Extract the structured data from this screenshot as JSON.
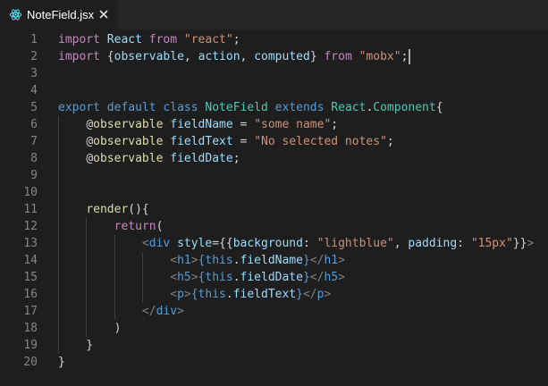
{
  "tab": {
    "title": "NoteField.jsx",
    "icon": "react-icon",
    "close_icon": "close-icon"
  },
  "colors": {
    "background": "#1e1e1e",
    "keyword": "#569cd6",
    "import_keyword": "#c586c0",
    "string": "#ce9178",
    "class_name": "#4ec9b0",
    "identifier": "#9cdcfe",
    "function": "#dcdcaa",
    "line_number": "#858585"
  },
  "lines": [
    {
      "n": "1",
      "tokens": [
        [
          "imp",
          "import"
        ],
        [
          "txt",
          " "
        ],
        [
          "ident",
          "React"
        ],
        [
          "txt",
          " "
        ],
        [
          "imp",
          "from"
        ],
        [
          "txt",
          " "
        ],
        [
          "str",
          "\"react\""
        ],
        [
          "txt",
          ";"
        ]
      ]
    },
    {
      "n": "2",
      "tokens": [
        [
          "imp",
          "import"
        ],
        [
          "txt",
          " {"
        ],
        [
          "ident",
          "observable"
        ],
        [
          "txt",
          ", "
        ],
        [
          "ident",
          "action"
        ],
        [
          "txt",
          ", "
        ],
        [
          "ident",
          "computed"
        ],
        [
          "txt",
          "} "
        ],
        [
          "imp",
          "from"
        ],
        [
          "txt",
          " "
        ],
        [
          "str",
          "\"mobx\""
        ],
        [
          "txt",
          ";"
        ]
      ]
    },
    {
      "n": "3",
      "tokens": []
    },
    {
      "n": "4",
      "tokens": []
    },
    {
      "n": "5",
      "tokens": [
        [
          "kw",
          "export"
        ],
        [
          "txt",
          " "
        ],
        [
          "kw",
          "default"
        ],
        [
          "txt",
          " "
        ],
        [
          "kw",
          "class"
        ],
        [
          "txt",
          " "
        ],
        [
          "cls",
          "NoteField"
        ],
        [
          "txt",
          " "
        ],
        [
          "kw",
          "extends"
        ],
        [
          "txt",
          " "
        ],
        [
          "cls",
          "React"
        ],
        [
          "txt",
          "."
        ],
        [
          "cls",
          "Component"
        ],
        [
          "txt",
          "{"
        ]
      ]
    },
    {
      "n": "6",
      "tokens": [
        [
          "txt",
          "    "
        ],
        [
          "dec",
          "@"
        ],
        [
          "fn",
          "observable"
        ],
        [
          "txt",
          " "
        ],
        [
          "ident",
          "fieldName"
        ],
        [
          "txt",
          " = "
        ],
        [
          "str",
          "\"some name\""
        ],
        [
          "txt",
          ";"
        ]
      ]
    },
    {
      "n": "7",
      "tokens": [
        [
          "txt",
          "    "
        ],
        [
          "dec",
          "@"
        ],
        [
          "fn",
          "observable"
        ],
        [
          "txt",
          " "
        ],
        [
          "ident",
          "fieldText"
        ],
        [
          "txt",
          " = "
        ],
        [
          "str",
          "\"No selected notes\""
        ],
        [
          "txt",
          ";"
        ]
      ]
    },
    {
      "n": "8",
      "tokens": [
        [
          "txt",
          "    "
        ],
        [
          "dec",
          "@"
        ],
        [
          "fn",
          "observable"
        ],
        [
          "txt",
          " "
        ],
        [
          "ident",
          "fieldDate"
        ],
        [
          "txt",
          ";"
        ]
      ]
    },
    {
      "n": "9",
      "tokens": []
    },
    {
      "n": "10",
      "tokens": []
    },
    {
      "n": "11",
      "tokens": [
        [
          "txt",
          "    "
        ],
        [
          "fn",
          "render"
        ],
        [
          "txt",
          "(){"
        ]
      ]
    },
    {
      "n": "12",
      "tokens": [
        [
          "txt",
          "        "
        ],
        [
          "imp",
          "return"
        ],
        [
          "txt",
          "("
        ]
      ]
    },
    {
      "n": "13",
      "tokens": [
        [
          "txt",
          "            "
        ],
        [
          "tagpunc",
          "<"
        ],
        [
          "tag",
          "div"
        ],
        [
          "txt",
          " "
        ],
        [
          "attr",
          "style"
        ],
        [
          "txt",
          "={{"
        ],
        [
          "ident",
          "background"
        ],
        [
          "txt",
          ": "
        ],
        [
          "str",
          "\"lightblue\""
        ],
        [
          "txt",
          ", "
        ],
        [
          "ident",
          "padding"
        ],
        [
          "txt",
          ": "
        ],
        [
          "str",
          "\"15px\""
        ],
        [
          "txt",
          "}}"
        ],
        [
          "tagpunc",
          ">"
        ]
      ]
    },
    {
      "n": "14",
      "tokens": [
        [
          "txt",
          "                "
        ],
        [
          "tagpunc",
          "<"
        ],
        [
          "tag",
          "h1"
        ],
        [
          "tagpunc",
          ">"
        ],
        [
          "kw",
          "{"
        ],
        [
          "kw",
          "this"
        ],
        [
          "txt",
          "."
        ],
        [
          "ident",
          "fieldName"
        ],
        [
          "kw",
          "}"
        ],
        [
          "tagpunc",
          "</"
        ],
        [
          "tag",
          "h1"
        ],
        [
          "tagpunc",
          ">"
        ]
      ]
    },
    {
      "n": "15",
      "tokens": [
        [
          "txt",
          "                "
        ],
        [
          "tagpunc",
          "<"
        ],
        [
          "tag",
          "h5"
        ],
        [
          "tagpunc",
          ">"
        ],
        [
          "kw",
          "{"
        ],
        [
          "kw",
          "this"
        ],
        [
          "txt",
          "."
        ],
        [
          "ident",
          "fieldDate"
        ],
        [
          "kw",
          "}"
        ],
        [
          "tagpunc",
          "</"
        ],
        [
          "tag",
          "h5"
        ],
        [
          "tagpunc",
          ">"
        ]
      ]
    },
    {
      "n": "16",
      "tokens": [
        [
          "txt",
          "                "
        ],
        [
          "tagpunc",
          "<"
        ],
        [
          "tag",
          "p"
        ],
        [
          "tagpunc",
          ">"
        ],
        [
          "kw",
          "{"
        ],
        [
          "kw",
          "this"
        ],
        [
          "txt",
          "."
        ],
        [
          "ident",
          "fieldText"
        ],
        [
          "kw",
          "}"
        ],
        [
          "tagpunc",
          "</"
        ],
        [
          "tag",
          "p"
        ],
        [
          "tagpunc",
          ">"
        ]
      ]
    },
    {
      "n": "17",
      "tokens": [
        [
          "txt",
          "            "
        ],
        [
          "tagpunc",
          "</"
        ],
        [
          "tag",
          "div"
        ],
        [
          "tagpunc",
          ">"
        ]
      ]
    },
    {
      "n": "18",
      "tokens": [
        [
          "txt",
          "        )"
        ]
      ]
    },
    {
      "n": "19",
      "tokens": [
        [
          "txt",
          "    }"
        ]
      ]
    },
    {
      "n": "20",
      "tokens": [
        [
          "txt",
          "}"
        ]
      ]
    }
  ]
}
